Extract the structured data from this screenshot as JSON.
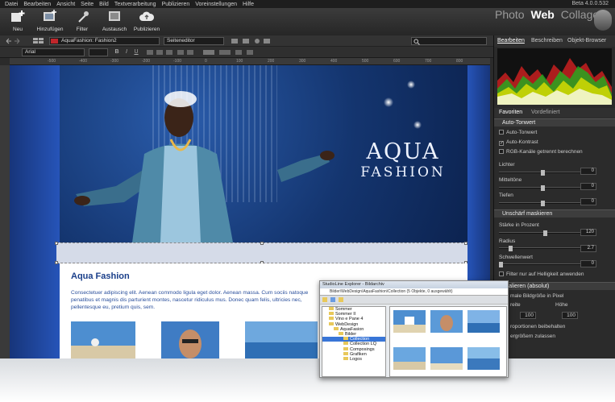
{
  "menu": [
    "Datei",
    "Bearbeiten",
    "Ansicht",
    "Seite",
    "Bild",
    "Textverarbeitung",
    "Publizieren",
    "Voreinstellungen",
    "Hilfe"
  ],
  "version": "Beta 4.0.0.532",
  "toolbar": {
    "new": "Neu",
    "add": "Hinzufügen",
    "filter": "Filter",
    "exchange": "Austausch",
    "publish": "Publizieren"
  },
  "modes": {
    "photo": "Photo",
    "web": "Web",
    "collage": "Collage",
    "active": "Web"
  },
  "document": {
    "name": "AquaFashion: Fashion2",
    "editor": "Seiteneditor"
  },
  "format": {
    "font": "Arial",
    "bold": "B",
    "italic": "I",
    "underline": "U"
  },
  "ruler": [
    "-500",
    "-400",
    "-300",
    "-200",
    "-100",
    "0",
    "100",
    "200",
    "300",
    "400",
    "500",
    "600",
    "700",
    "800",
    "900"
  ],
  "site": {
    "brand_top": "AQUA",
    "brand_bottom": "FASHION",
    "heading": "Aqua Fashion",
    "body": "Consectetuer adipiscing elit. Aenean commodo ligula eget dolor. Aenean massa. Cum sociis natoque penatibus et magnis dis parturient montes, nascetur ridiculus mus. Donec quam felis, ultricies nec, pellentesque eu, pretium quis, sem."
  },
  "panel": {
    "tabs": [
      "Bearbeiten",
      "Beschreiben",
      "Objekt-Browser"
    ],
    "subtabs": [
      "Favoriten",
      "Vordefiniert"
    ],
    "auto_tone": {
      "title": "Auto-Tonwert",
      "auto_tone": "Auto-Tonwert",
      "auto_contrast": "Auto-Kontrast",
      "rgb_separate": "RGB-Kanäle getrennt berechnen",
      "lights": "Lichter",
      "lights_value": "0",
      "mids": "Mitteltöne",
      "mids_value": "0",
      "depths": "Tiefen",
      "depths_value": "0"
    },
    "unsharp": {
      "title": "Unschärf maskieren",
      "strength": "Stärke in Prozent",
      "strength_value": "120",
      "radius": "Radius",
      "radius_value": "2.7",
      "threshold": "Schwellenwert",
      "threshold_value": "0",
      "filter_lightness": "Filter nur auf Helligkeit anwenden"
    },
    "scale": {
      "title": "Skalieren (absolut)",
      "new_size": "male Bildgröße in Pixel",
      "width": "reite",
      "height": "Höhe",
      "width_value": "100",
      "height_value": "100",
      "keep_proportions": "roportionen beibehalten",
      "allow_enlarge": "ergrößern zulassen"
    }
  },
  "explorer": {
    "title": "StudioLine Explorer - Bildarchiv",
    "path": "Bilder\\WebDesign\\AquaFashion\\Collection   (5 Objekte, 0 ausgewählt)",
    "tree": [
      "Sommer",
      "Sommer II",
      "Vino e Pane 4",
      "WebDesign",
      "AquaFasion",
      "Bilder",
      "Collection",
      "Collection LQ",
      "Composings",
      "Grafiken",
      "Logos"
    ],
    "selected": "Collection"
  },
  "colors": {
    "accent": "#e8b84a",
    "brand_blue": "#1a3f8a",
    "canvas_blue": "#16306a",
    "selection": "#3875d7"
  }
}
